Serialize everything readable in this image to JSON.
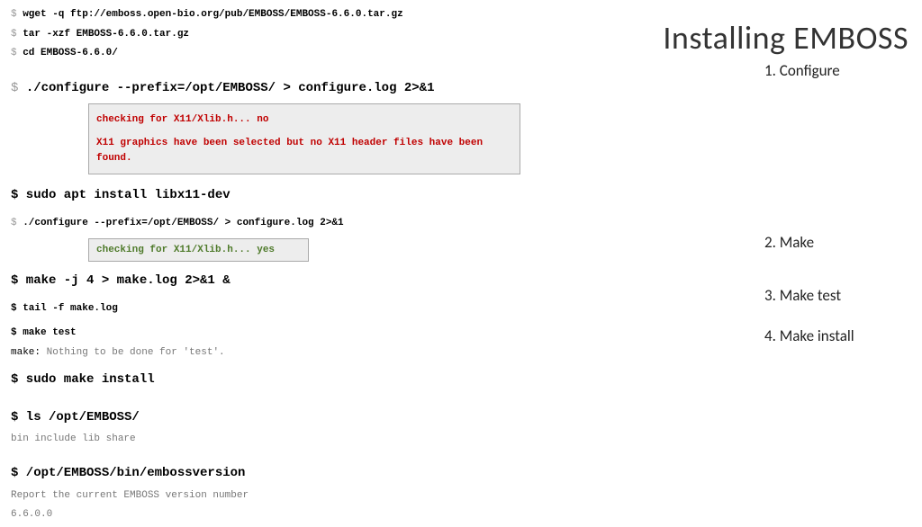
{
  "left": {
    "wget": "wget -q ftp://emboss.open-bio.org/pub/EMBOSS/EMBOSS-6.6.0.tar.gz",
    "tar": "tar -xzf EMBOSS-6.6.0.tar.gz",
    "cd": "cd EMBOSS-6.6.0/",
    "configure1": "./configure --prefix=/opt/EMBOSS/ > configure.log 2>&1",
    "error_line1": "checking for X11/Xlib.h... no",
    "error_line2": "X11 graphics have been selected but no X11 header files have been found.",
    "apt_install": "$ sudo apt install libx11-dev",
    "configure2": "./configure --prefix=/opt/EMBOSS/ > configure.log 2>&1",
    "success_line": "checking for X11/Xlib.h... yes",
    "make": "$ make -j 4 > make.log 2>&1 &",
    "tail": "$ tail -f make.log",
    "maketest": "$ make test",
    "maketest_out_pre": "make:",
    "maketest_out": " Nothing to be done for 'test'.",
    "makeinstall": "$ sudo make install",
    "ls": "$ ls /opt/EMBOSS/",
    "ls_out": "bin  include  lib  share",
    "version": "$ /opt/EMBOSS/bin/embossversion",
    "version_out1": "Report the current EMBOSS version number",
    "version_out2": "6.6.0.0"
  },
  "right": {
    "title": "Installing EMBOSS",
    "step1": "1. Configure",
    "step2": "2. Make",
    "step3": "3. Make test",
    "step4": "4. Make install"
  }
}
